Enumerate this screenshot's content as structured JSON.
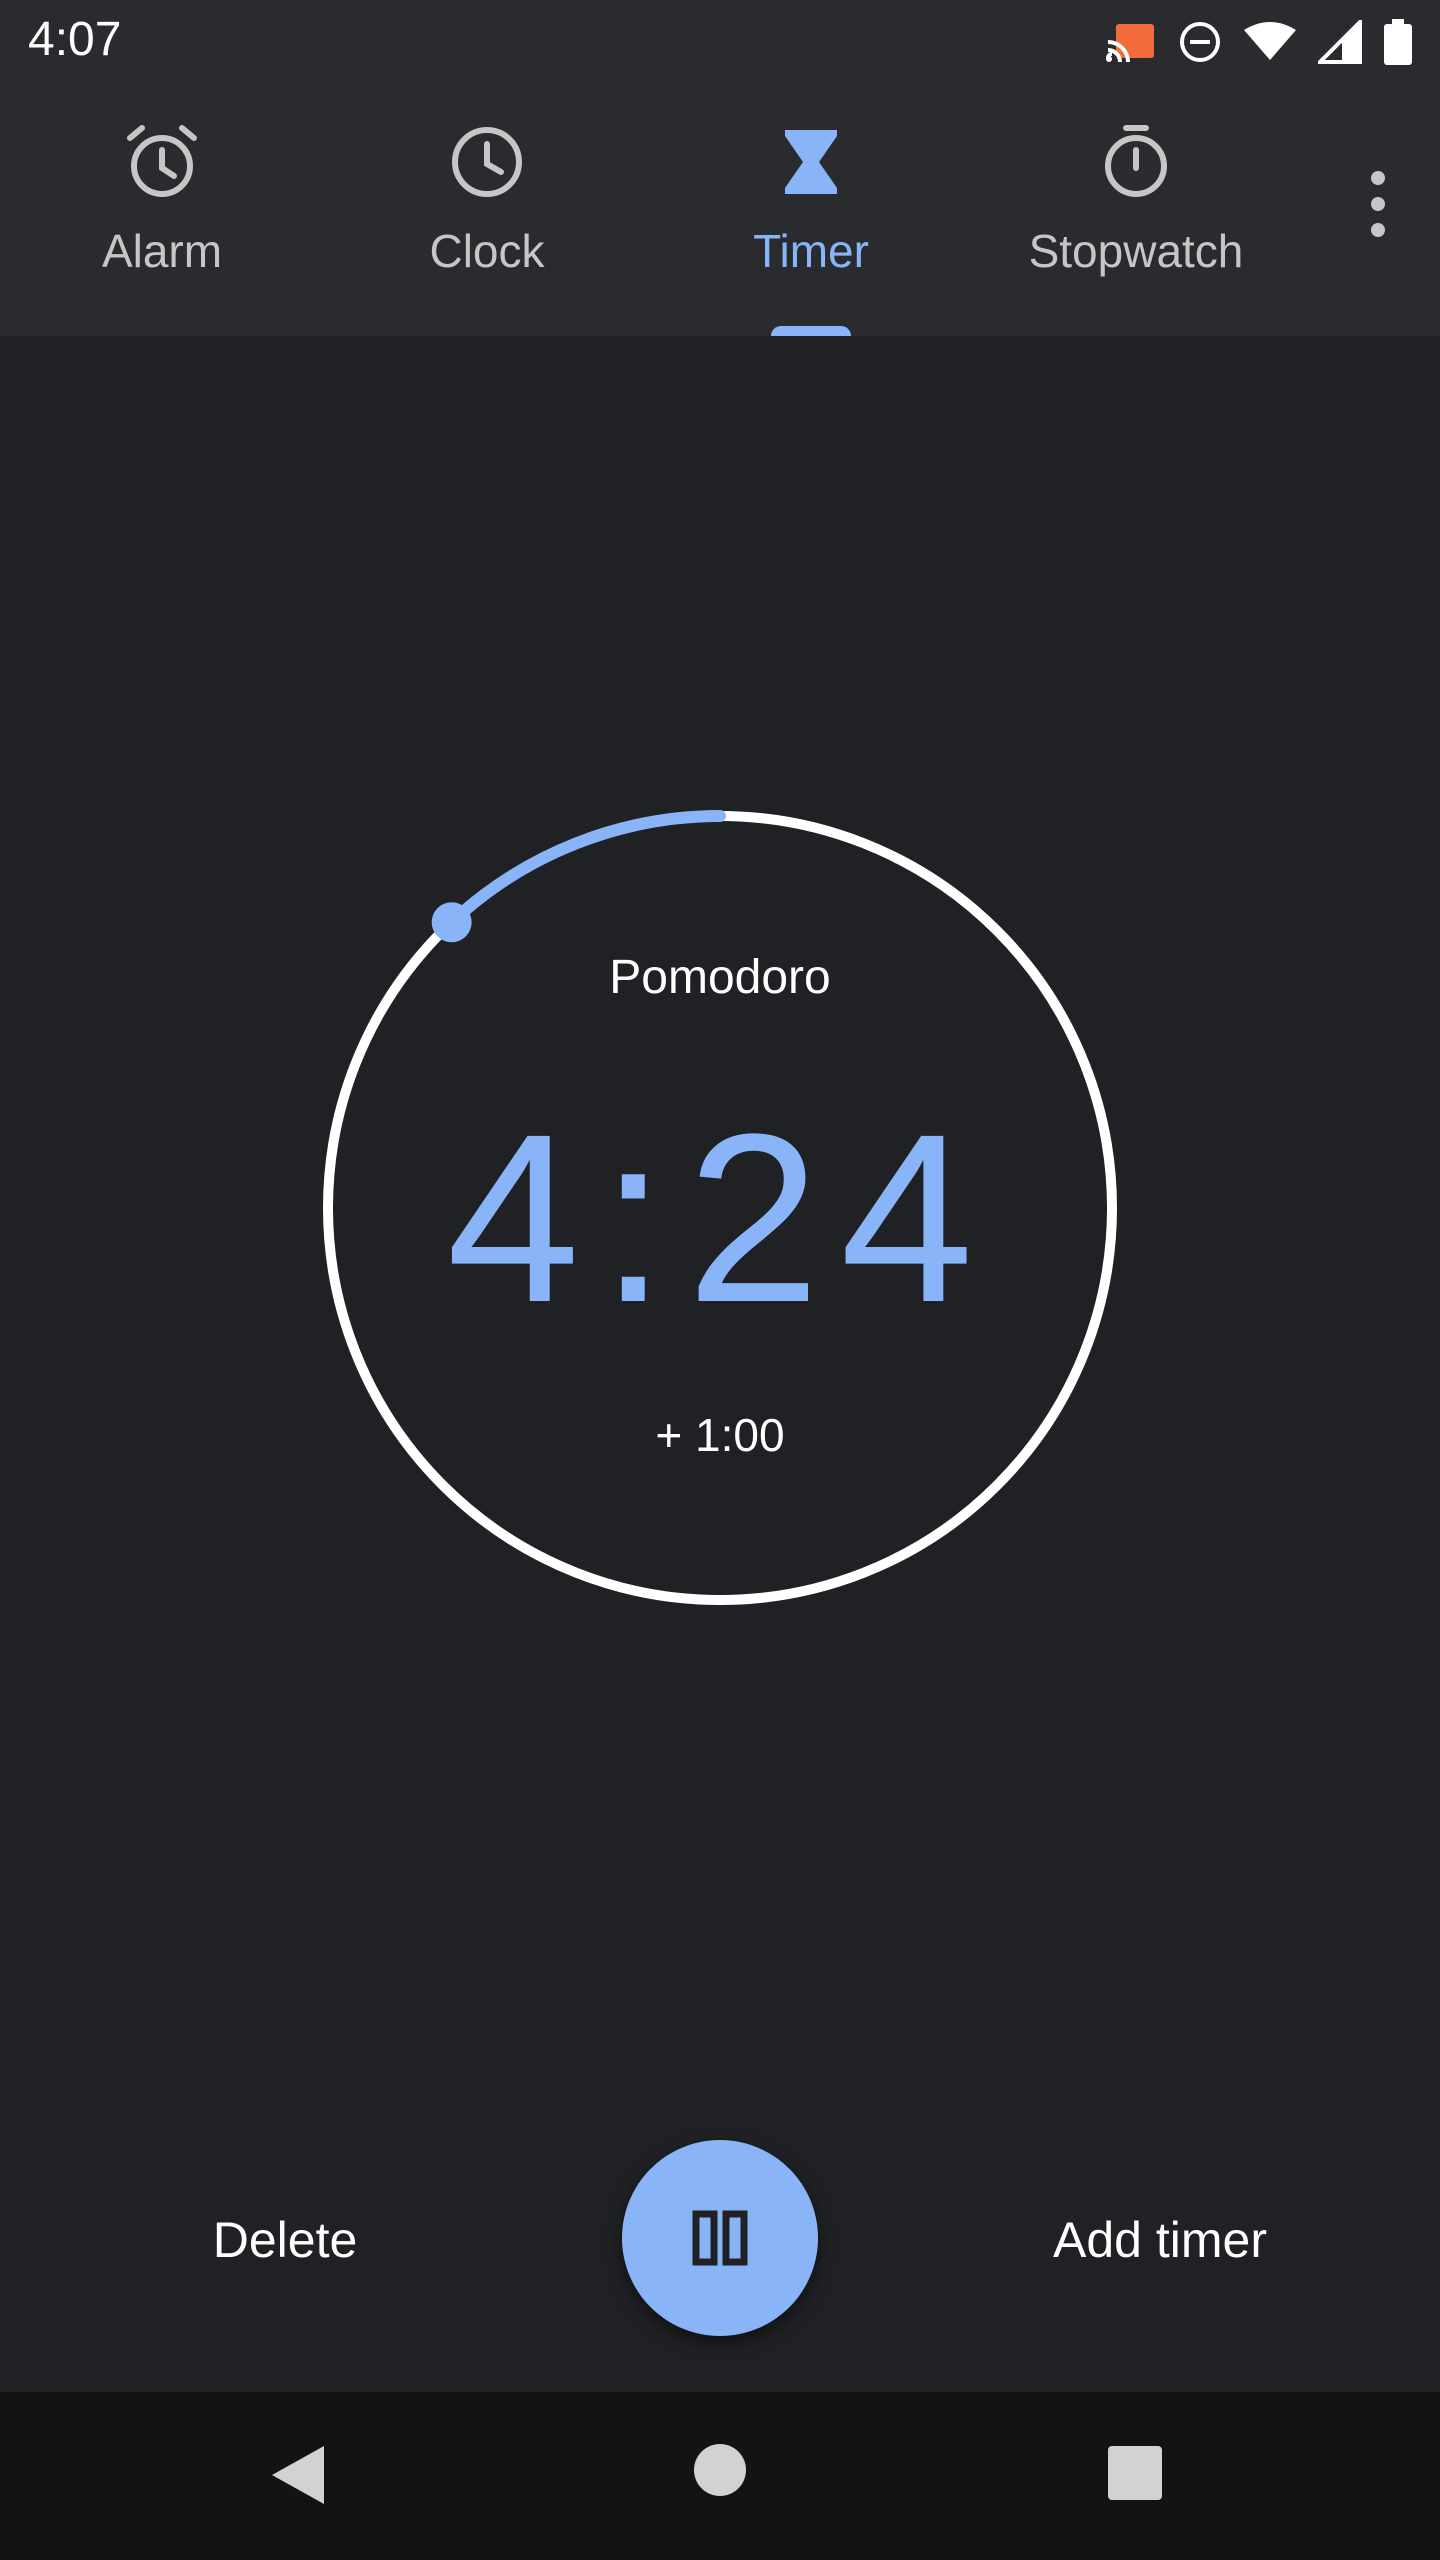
{
  "status_bar": {
    "time": "4:07",
    "icons": [
      "cast-icon",
      "do-not-disturb-icon",
      "wifi-icon",
      "signal-icon",
      "battery-icon"
    ],
    "cast_color": "#f26b3a"
  },
  "tabs": [
    {
      "label": "Alarm",
      "icon": "alarm-icon",
      "active": false
    },
    {
      "label": "Clock",
      "icon": "clock-icon",
      "active": false
    },
    {
      "label": "Timer",
      "icon": "hourglass-icon",
      "active": true
    },
    {
      "label": "Stopwatch",
      "icon": "stopwatch-icon",
      "active": false
    }
  ],
  "menu": {
    "icon": "more-vert-icon"
  },
  "timer": {
    "label": "Pomodoro",
    "remaining": "4:24",
    "add_time_label": "+ 1:00",
    "progress_elapsed_fraction": 0.12
  },
  "actions": {
    "delete_label": "Delete",
    "add_timer_label": "Add timer",
    "pause_icon": "pause-icon"
  },
  "colors": {
    "accent": "#8ab4f8",
    "background": "#202124",
    "bar": "#2a2b2f"
  },
  "nav": {
    "back_icon": "back-icon",
    "home_icon": "home-icon",
    "recents_icon": "recents-icon"
  }
}
